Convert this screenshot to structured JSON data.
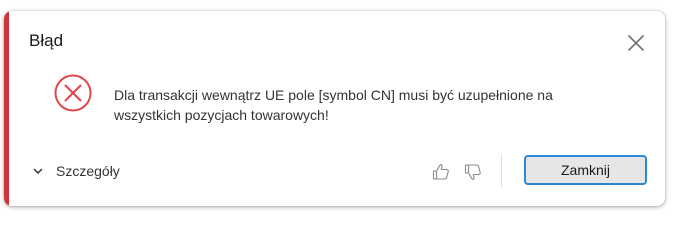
{
  "dialog": {
    "title": "Błąd",
    "message_line1": "Dla transakcji wewnątrz UE pole [symbol CN] musi być uzupełnione na",
    "message_line2": "wszystkich pozycjach towarowych!",
    "details_label": "Szczegóły",
    "close_button_label": "Zamknij",
    "accent_color": "#d13438",
    "error_icon_color": "#e0474c",
    "focus_color": "#2b88d8",
    "icons": {
      "close": "close-icon",
      "error": "error-circle-icon",
      "details": "chevron-down-icon",
      "like": "thumbs-up-icon",
      "dislike": "thumbs-down-icon"
    }
  }
}
